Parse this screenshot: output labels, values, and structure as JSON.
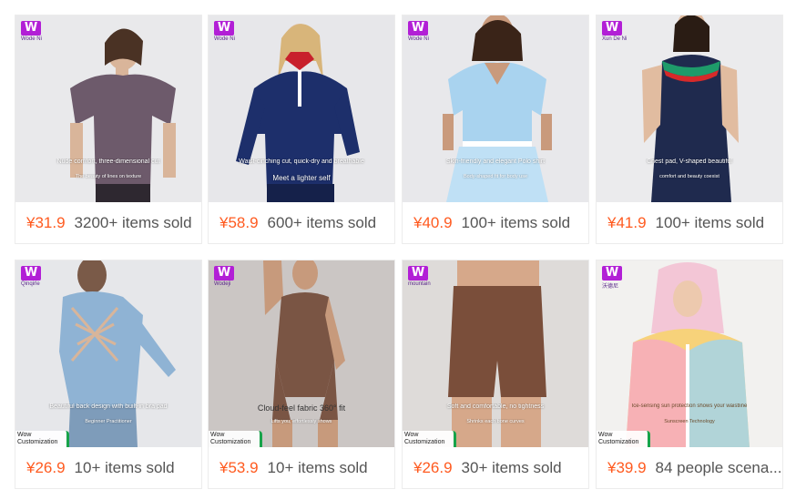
{
  "products": [
    {
      "brand": "Wode Ni",
      "caption": "Nude comfort, three-dimensional cut",
      "subcaption": "The beauty of lines on texture",
      "badge": "",
      "price": "¥31.9",
      "sold": "3200+ items sold"
    },
    {
      "brand": "Wode Ni",
      "caption": "Waist-cinching cut, quick-dry and breathable",
      "subcaption": "Meet a lighter self",
      "badge": "",
      "price": "¥58.9",
      "sold": "600+ items sold"
    },
    {
      "brand": "Wode Ni",
      "caption": "Skin-friendly and elegant Polo shirt",
      "subcaption": "Body-shaped fit for body use",
      "badge": "",
      "price": "¥40.9",
      "sold": "100+ items sold"
    },
    {
      "brand": "Xun De Ni",
      "caption": "Chest pad, V-shaped beautiful",
      "subcaption": "comfort and beauty coexist",
      "badge": "",
      "price": "¥41.9",
      "sold": "100+ items sold"
    },
    {
      "brand": "Qinqirle",
      "caption": "Beautiful back design with built-in bra pad",
      "subcaption": "Beginner Practitioner",
      "badge": "Wow\nCustomization",
      "price": "¥26.9",
      "sold": "10+ items sold"
    },
    {
      "brand": "Wodeji",
      "caption": "Cloud-feel fabric 360° fit",
      "subcaption": "Lifts you, effortlessly shows",
      "badge": "Wow\nCustomization",
      "price": "¥53.9",
      "sold": "10+ items sold"
    },
    {
      "brand": "mountain",
      "caption": "Soft and comfortable, no tightness",
      "subcaption": "Shrinks each bone curves",
      "badge": "Wow\nCustomization",
      "price": "¥26.9",
      "sold": "30+ items sold"
    },
    {
      "brand": "沃德尼",
      "caption": "Ice-sensing sun protection shows your waistline",
      "subcaption": "Sunscreen Technology",
      "badge": "Wow\nCustomization",
      "price": "¥39.9",
      "sold": "84 people scena..."
    }
  ],
  "colors": {
    "price": "#ff5a1f",
    "logo": "#b21fd6",
    "badge_accent": "#17a34a"
  },
  "icons": [
    "brand-logo-icon"
  ]
}
